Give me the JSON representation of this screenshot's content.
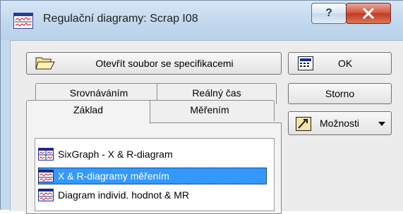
{
  "window": {
    "title": "Regulační diagramy: Scrap I08",
    "help_label": "?"
  },
  "buttons": {
    "open_spec_label": "Otevřít soubor se specifikacemi",
    "ok_label": "OK",
    "storno_label": "Storno",
    "options_label": "Možnosti"
  },
  "tabs": {
    "back_row": [
      "Srovnáváním",
      "Reálný čas"
    ],
    "front_row": [
      "Základ",
      "Měřením"
    ],
    "active": "Základ"
  },
  "list": {
    "items": [
      {
        "label": "SixGraph - X & R-diagram",
        "icon": "sixgraph-chart-icon"
      },
      {
        "label": "X & R-diagramy měřením",
        "icon": "control-chart-icon",
        "selected": true
      },
      {
        "label": "Diagram individ. hodnot & MR",
        "icon": "control-chart-icon"
      }
    ]
  },
  "colors": {
    "selection": "#3399ff",
    "close_button": "#c9442b",
    "title_bar": "#c9dcf0"
  }
}
